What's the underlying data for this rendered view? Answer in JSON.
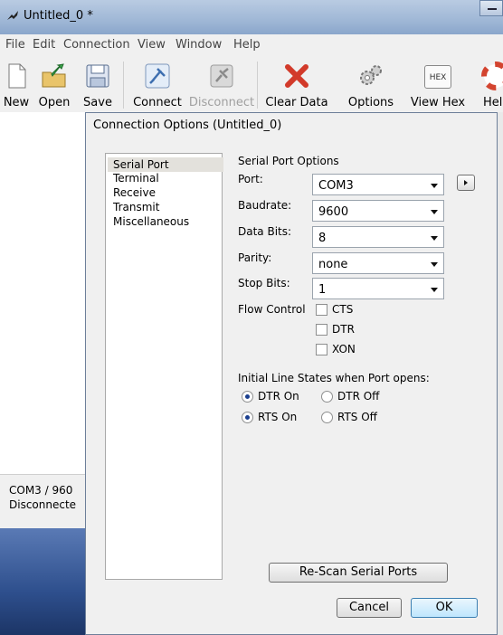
{
  "window": {
    "title": "Untitled_0 *"
  },
  "menubar": [
    "File",
    "Edit",
    "Connection",
    "View",
    "Window",
    "Help"
  ],
  "toolbar": {
    "new": "New",
    "open": "Open",
    "save": "Save",
    "connect": "Connect",
    "disconnect": "Disconnect",
    "clear_data": "Clear Data",
    "options": "Options",
    "view_hex": "View Hex",
    "help": "Hel",
    "hex_icon_text": "HEX"
  },
  "status": {
    "port": "COM3 / 960",
    "state": "Disconnecte"
  },
  "dialog": {
    "title": "Connection Options (Untitled_0)",
    "categories": [
      "Serial Port",
      "Terminal",
      "Receive",
      "Transmit",
      "Miscellaneous"
    ],
    "selected_category": "Serial Port",
    "group_title": "Serial Port Options",
    "fields": {
      "port": {
        "label": "Port:",
        "value": "COM3"
      },
      "baudrate": {
        "label": "Baudrate:",
        "value": "9600"
      },
      "databits": {
        "label": "Data Bits:",
        "value": "8"
      },
      "parity": {
        "label": "Parity:",
        "value": "none"
      },
      "stopbits": {
        "label": "Stop Bits:",
        "value": "1"
      }
    },
    "flow_control": {
      "label": "Flow Control",
      "options": [
        {
          "label": "CTS",
          "checked": false
        },
        {
          "label": "DTR",
          "checked": false
        },
        {
          "label": "XON",
          "checked": false
        }
      ]
    },
    "line_states": {
      "heading": "Initial Line States when Port opens:",
      "dtr_on": "DTR On",
      "dtr_off": "DTR Off",
      "rts_on": "RTS On",
      "rts_off": "RTS Off",
      "dtr_selected": "DTR On",
      "rts_selected": "RTS On"
    },
    "rescan_button": "Re-Scan Serial Ports",
    "cancel_button": "Cancel",
    "ok_button": "OK"
  },
  "colors": {
    "accent": "#1b3f8f",
    "titlebar": "#9fb7d6",
    "dialog_bg": "#f0f0f0"
  }
}
